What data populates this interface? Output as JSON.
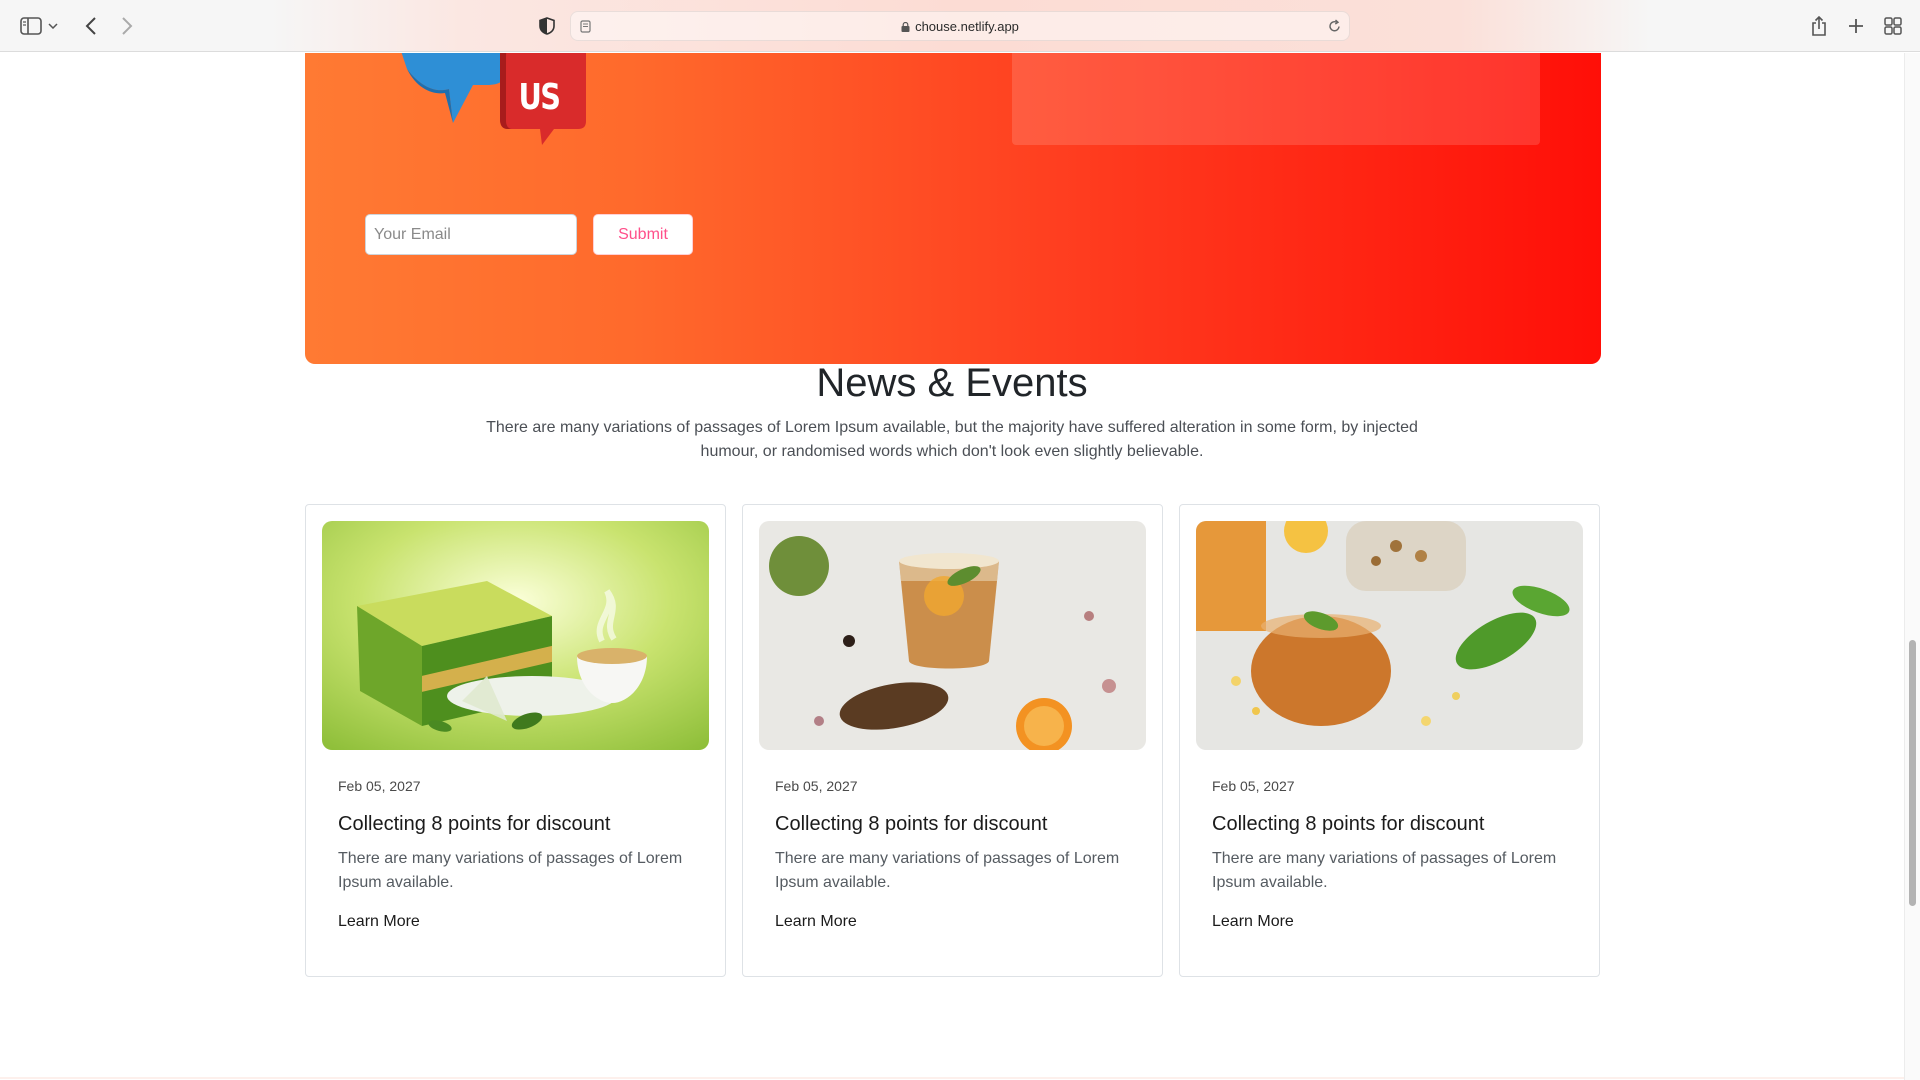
{
  "browser": {
    "url": "chouse.netlify.app"
  },
  "contact": {
    "logo_text": "US",
    "email_placeholder": "Your Email",
    "submit_label": "Submit"
  },
  "news": {
    "title": "News & Events",
    "subtitle": "There are many variations of passages of Lorem Ipsum available, but the majority have suffered alteration in some form, by injected humour, or randomised words which don't look even slightly believable.",
    "cards": [
      {
        "date": "Feb 05, 2027",
        "title": "Collecting 8 points for discount",
        "text": "There are many variations of passages of Lorem Ipsum available.",
        "link": "Learn More"
      },
      {
        "date": "Feb 05, 2027",
        "title": "Collecting 8 points for discount",
        "text": "There are many variations of passages of Lorem Ipsum available.",
        "link": "Learn More"
      },
      {
        "date": "Feb 05, 2027",
        "title": "Collecting 8 points for discount",
        "text": "There are many variations of passages of Lorem Ipsum available.",
        "link": "Learn More"
      }
    ]
  },
  "colors": {
    "banner_start": "#ff7a33",
    "banner_end": "#ff0f08",
    "submit_text": "#ff4f8a"
  }
}
